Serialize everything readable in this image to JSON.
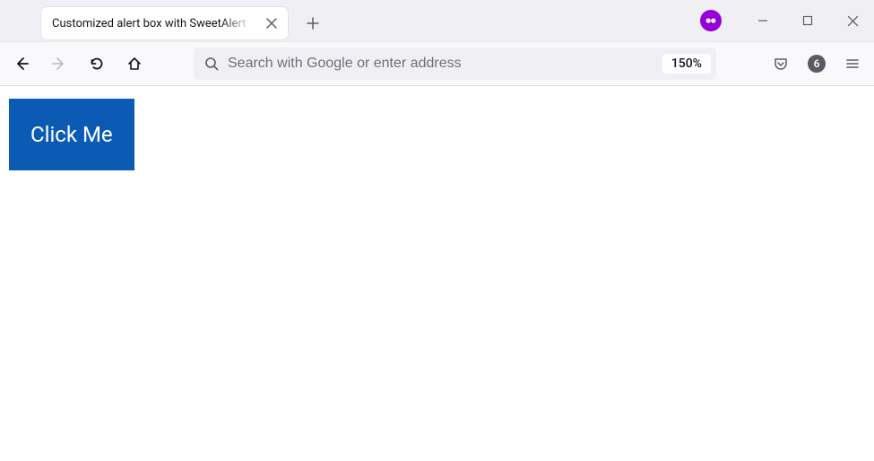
{
  "tab": {
    "title": "Customized alert box with SweetAlert"
  },
  "nav": {
    "urlbar_placeholder": "Search with Google or enter address",
    "zoom_level": "150%",
    "count_badge": "6"
  },
  "page": {
    "button_label": "Click Me"
  }
}
